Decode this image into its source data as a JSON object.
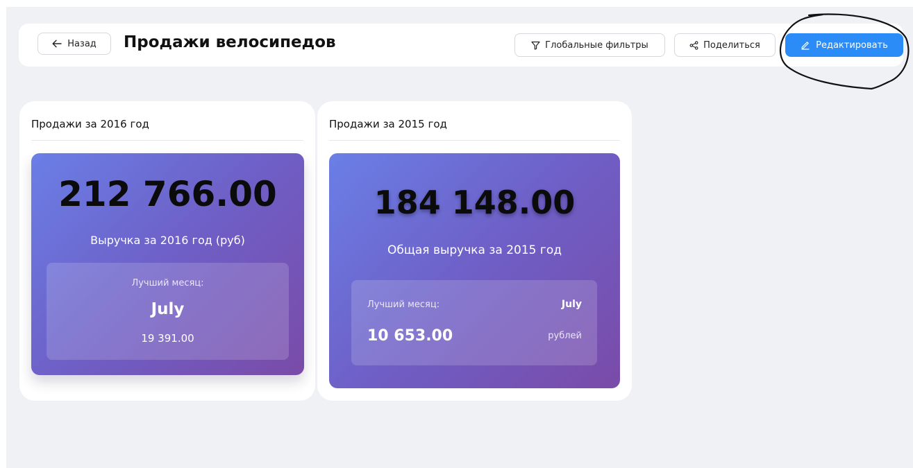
{
  "header": {
    "back_label": "Назад",
    "title": "Продажи велосипедов",
    "filters_label": "Глобальные фильтры",
    "share_label": "Поделиться",
    "edit_label": "Редактировать"
  },
  "cards": [
    {
      "title": "Продажи за 2016 год",
      "value": "212 766.00",
      "caption": "Выручка за 2016 год (руб)",
      "best_month_label": "Лучший месяц:",
      "best_month": "July",
      "best_month_amount": "19 391.00"
    },
    {
      "title": "Продажи за 2015 год",
      "value": "184 148.00",
      "caption": "Общая выручка за 2015 год",
      "best_month_label": "Лучший месяц:",
      "best_month": "July",
      "best_month_amount": "10 653.00",
      "best_month_unit": "рублей"
    }
  ],
  "colors": {
    "accent": "#2b8cf7",
    "kpi_gradient_start": "#6a7fe6",
    "kpi_gradient_end": "#7a4ba8",
    "background": "#f0f1f5"
  },
  "icons": {
    "back": "arrow-left-icon",
    "filters": "filter-icon",
    "share": "share-icon",
    "edit": "pencil-icon"
  }
}
